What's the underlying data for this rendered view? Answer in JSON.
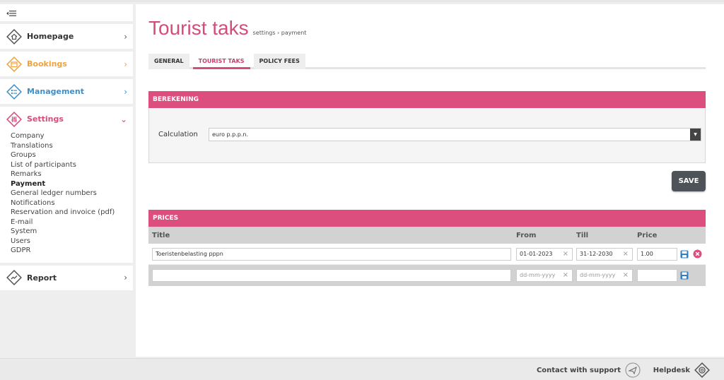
{
  "colors": {
    "accent": "#d64b7c",
    "homepage": "#555555",
    "bookings": "#f0a23e",
    "management": "#3f8fc7",
    "settings": "#d64b7c",
    "dark": "#4d5358"
  },
  "sidebar": {
    "items": [
      {
        "label": "Homepage",
        "icon": "home-icon"
      },
      {
        "label": "Bookings",
        "icon": "calendar-icon"
      },
      {
        "label": "Management",
        "icon": "list-icon"
      },
      {
        "label": "Settings",
        "icon": "sliders-icon"
      },
      {
        "label": "Report",
        "icon": "chart-line-icon"
      }
    ],
    "settings_sub": [
      "Company",
      "Translations",
      "Groups",
      "List of participants",
      "Remarks",
      "Payment",
      "General ledger numbers",
      "Notifications",
      "Reservation and invoice (pdf)",
      "E-mail",
      "System",
      "Users",
      "GDPR"
    ],
    "active_sub": "Payment"
  },
  "header": {
    "title": "Tourist taks",
    "breadcrumb": "settings › payment"
  },
  "tabs": [
    {
      "label": "GENERAL",
      "active": false
    },
    {
      "label": "TOURIST TAKS",
      "active": true
    },
    {
      "label": "POLICY FEES",
      "active": false
    }
  ],
  "berekening": {
    "header": "BEREKENING",
    "calc_label": "Calculation",
    "calc_value": "euro p.p.p.n."
  },
  "save_label": "SAVE",
  "prices": {
    "header": "PRICES",
    "columns": {
      "title": "Title",
      "from": "From",
      "till": "Till",
      "price": "Price"
    },
    "rows": [
      {
        "title": "Toeristenbelasting pppn",
        "from": "01-01-2023",
        "till": "31-12-2030",
        "price": "1.00"
      }
    ],
    "new_row": {
      "title": "",
      "from_placeholder": "dd-mm-yyyy",
      "till_placeholder": "dd-mm-yyyy",
      "price": ""
    }
  },
  "footer": {
    "support_label": "Contact with support",
    "helpdesk_label": "Helpdesk"
  }
}
